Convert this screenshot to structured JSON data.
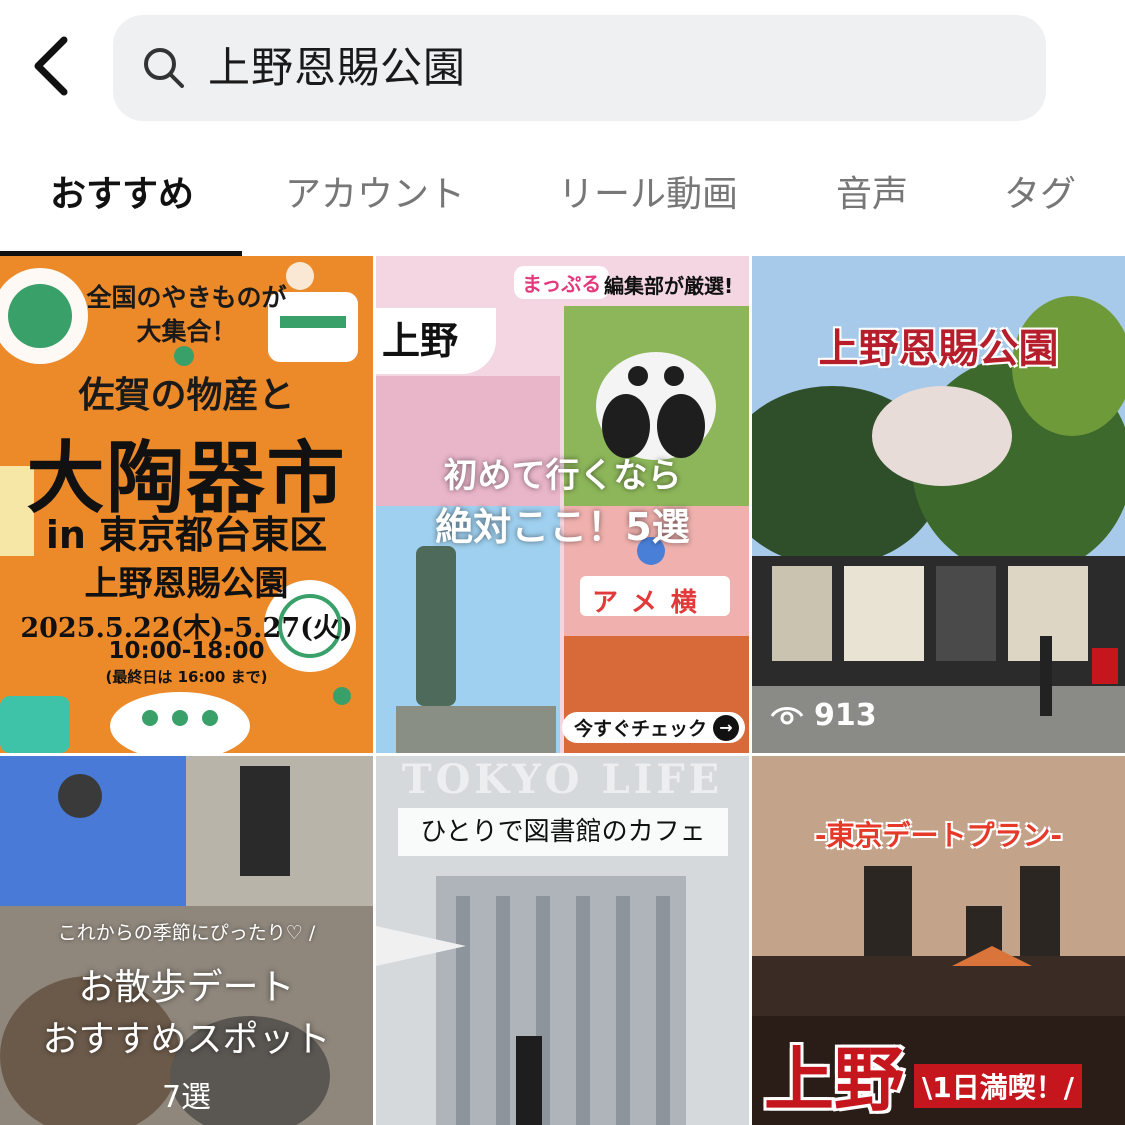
{
  "search": {
    "query": "上野恩賜公園"
  },
  "tabs": [
    {
      "label": "おすすめ"
    },
    {
      "label": "アカウント"
    },
    {
      "label": "リール動画"
    },
    {
      "label": "音声"
    },
    {
      "label": "タグ"
    }
  ],
  "active_tab": "おすすめ",
  "results": {
    "tile1": {
      "line1": "全国のやきものが",
      "line2": "大集合！",
      "line3": "佐賀の物産と",
      "line4": "大陶器市",
      "line5": "in 東京都台東区",
      "line6": "上野恩賜公園",
      "line7": "2025.5.22(木)-5.27(火)",
      "line8": "10:00-18:00",
      "line9": "(最終日は 16:00 まで)"
    },
    "tile2": {
      "brand": "まっぷる",
      "brand_sub": "編集部が厳選!",
      "tag": "上野",
      "headline1": "初めて行くなら",
      "headline2": "絶対ここ！5選",
      "sign": "アメ横",
      "cta": "今すぐチェック"
    },
    "tile3": {
      "title": "上野恩賜公園",
      "views": "913"
    },
    "tile4": {
      "caption": "これからの季節にぴったり♡ /",
      "headline1": "お散歩デート",
      "headline2": "おすすめスポット",
      "count": "7選"
    },
    "tile5": {
      "bg_word": "TOKYO LIFE",
      "banner": "ひとりで図書館のカフェ"
    },
    "tile6": {
      "title": "-東京デートプラン-",
      "big": "上野",
      "sub": "\\1日満喫！/"
    }
  },
  "colors": {
    "search_bg": "#eff0f2",
    "tab_active": "#111111",
    "tab_inactive": "#777777",
    "tile1_bg": "#ec8a2a",
    "accent_red": "#c4161c"
  }
}
